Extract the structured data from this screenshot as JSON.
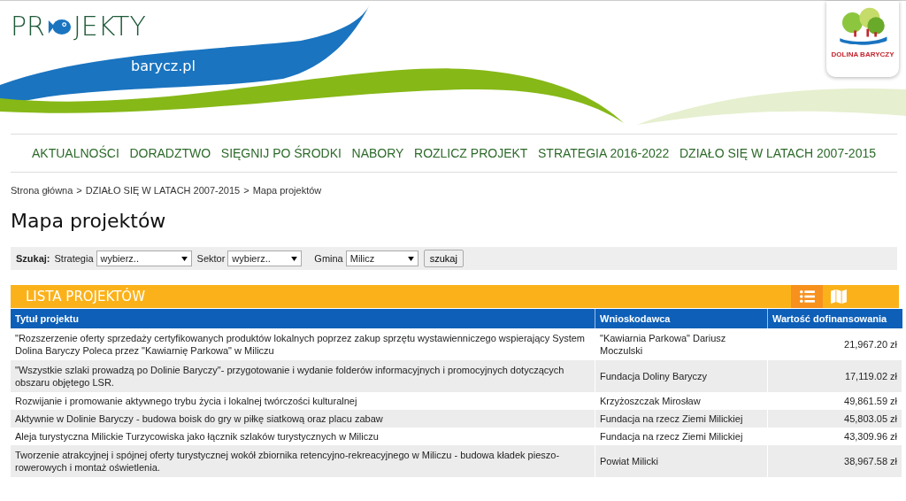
{
  "header": {
    "logo_parts": [
      "PR",
      "JEKTY"
    ],
    "subtitle": "barycz.pl",
    "partner_logo": "DOLINA BARYCZY"
  },
  "nav": [
    "AKTUALNOŚCI",
    "DORADZTWO",
    "SIĘGNIJ PO ŚRODKI",
    "NABORY",
    "ROZLICZ PROJEKT",
    "STRATEGIA 2016-2022",
    "DZIAŁO SIĘ W LATACH 2007-2015"
  ],
  "breadcrumb": [
    "Strona główna",
    "DZIAŁO SIĘ W LATACH 2007-2015",
    "Mapa projektów"
  ],
  "breadcrumb_separator": ">",
  "title": "Mapa projektów",
  "search": {
    "label": "Szukaj:",
    "filters": [
      {
        "label": "Strategia",
        "value": "wybierz.."
      },
      {
        "label": "Sektor",
        "value": "wybierz.."
      },
      {
        "label": "Gmina",
        "value": "Milicz"
      }
    ],
    "button": "szukaj"
  },
  "list": {
    "title": "LISTA PROJEKTÓW",
    "views": [
      {
        "kind": "list",
        "selected": true
      },
      {
        "kind": "map",
        "selected": false
      }
    ],
    "columns": [
      "Tytuł projektu",
      "Wnioskodawca",
      "Wartość dofinansowania"
    ],
    "rows": [
      [
        "\"Rozszerzenie oferty sprzedaży certyfikowanych produktów lokalnych poprzez zakup sprzętu wystawienniczego wspierający System Dolina Baryczy Poleca przez \"Kawiarnię Parkowa\" w Miliczu",
        "\"Kawiarnia Parkowa\" Dariusz Moczulski",
        "21,967.20 zł"
      ],
      [
        "\"Wszystkie szlaki prowadzą po Dolinie Baryczy\"- przygotowanie i wydanie folderów informacyjnych i promocyjnych dotyczących obszaru objętego LSR.",
        "Fundacja Doliny Baryczy",
        "17,119.02 zł"
      ],
      [
        "Rozwijanie i promowanie aktywnego trybu życia i lokalnej twórczości kulturalnej",
        "Krzyżoszczak Mirosław",
        "49,861.59 zł"
      ],
      [
        "Aktywnie w Dolinie Baryczy - budowa boisk do gry w piłkę siatkową oraz placu zabaw",
        "Fundacja na rzecz Ziemi Milickiej",
        "45,803.05 zł"
      ],
      [
        "Aleja turystyczna Milickie Turzycowiska jako łącznik szlaków turystycznych w Miliczu",
        "Fundacja na rzecz Ziemi Milickiej",
        "43,309.96 zł"
      ],
      [
        "Tworzenie atrakcyjnej i spójnej oferty turystycznej wokół zbiornika retencyjno-rekreacyjnego w Miliczu - budowa kładek pieszo-rowerowych i montaż oświetlenia.",
        "Powiat Milicki",
        "38,967.58 zł"
      ]
    ]
  }
}
